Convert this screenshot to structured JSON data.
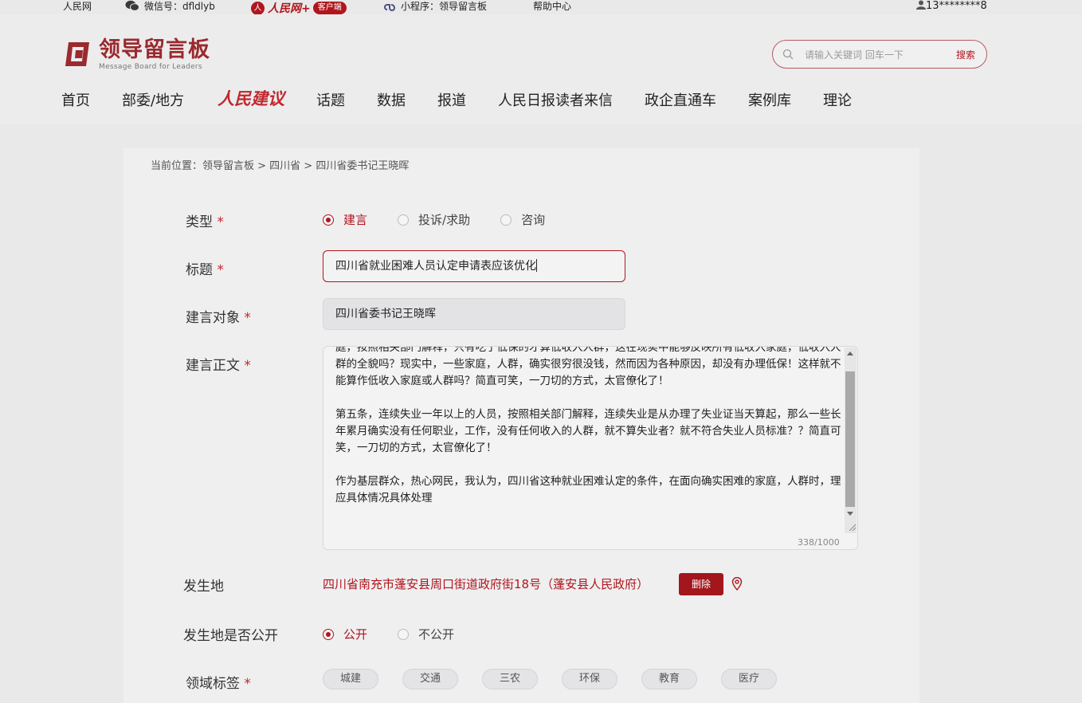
{
  "topbar": {
    "people_net": "人民网",
    "wechat": "微信号：dfldlyb",
    "client_logo_text": "人民网+",
    "client_pill": "客户端",
    "mini_program": "小程序：领导留言板",
    "help": "帮助中心",
    "user": "13********8"
  },
  "brand": {
    "name": "领导留言板",
    "english": "Message Board for Leaders",
    "color": "#9a2a2e"
  },
  "search": {
    "placeholder": "请输入关键词 回车一下",
    "button": "搜索"
  },
  "nav": {
    "items": [
      "首页",
      "部委/地方",
      "人民建议",
      "话题",
      "数据",
      "报道",
      "人民日报读者来信",
      "政企直通车",
      "案例库",
      "理论"
    ]
  },
  "breadcrumb": "当前位置：领导留言板 > 四川省 > 四川省委书记王晓晖",
  "form": {
    "type_label": "类型",
    "type_options": [
      "建言",
      "投诉/求助",
      "咨询"
    ],
    "title_label": "标题",
    "title_value": "四川省就业困难人员认定申请表应该优化",
    "target_label": "建言对象",
    "target_value": "四川省委书记王晓晖",
    "body_label": "建言正文",
    "body_paragraphs": [
      "庭，按照相关部门解释，只有吃了低保的才算低收入人群，这在现实中能够反映所有低收入家庭，低收入人群的全貌吗？现实中，一些家庭，人群，确实很穷很没钱，然而因为各种原因，却没有办理低保！这样就不能算作低收入家庭或人群吗？简直可笑，一刀切的方式，太官僚化了！",
      "第五条，连续失业一年以上的人员，按照相关部门解释，连续失业是从办理了失业证当天算起，那么一些长年累月确实没有任何职业，工作，没有任何收入的人群，就不算失业者？就不符合失业人员标准？？简直可笑，一刀切的方式，太官僚化了！",
      "作为基层群众，热心网民，我认为，四川省这种就业困难认定的条件，在面向确实困难的家庭，人群时，理应具体情况具体处理"
    ],
    "counter": "338/1000",
    "place_label": "发生地",
    "place_value": "四川省南充市蓬安县周口街道政府街18号（蓬安县人民政府）",
    "delete_button": "删除",
    "public_label": "发生地是否公开",
    "public_options": [
      "公开",
      "不公开"
    ],
    "domain_label": "领域标签",
    "domain_tags": [
      "城建",
      "交通",
      "三农",
      "环保",
      "教育",
      "医疗"
    ],
    "required_mark": "*"
  },
  "colors": {
    "accent": "#b0161d",
    "page_bg": "#e9e9ea",
    "panel_bg": "#efeff0"
  }
}
